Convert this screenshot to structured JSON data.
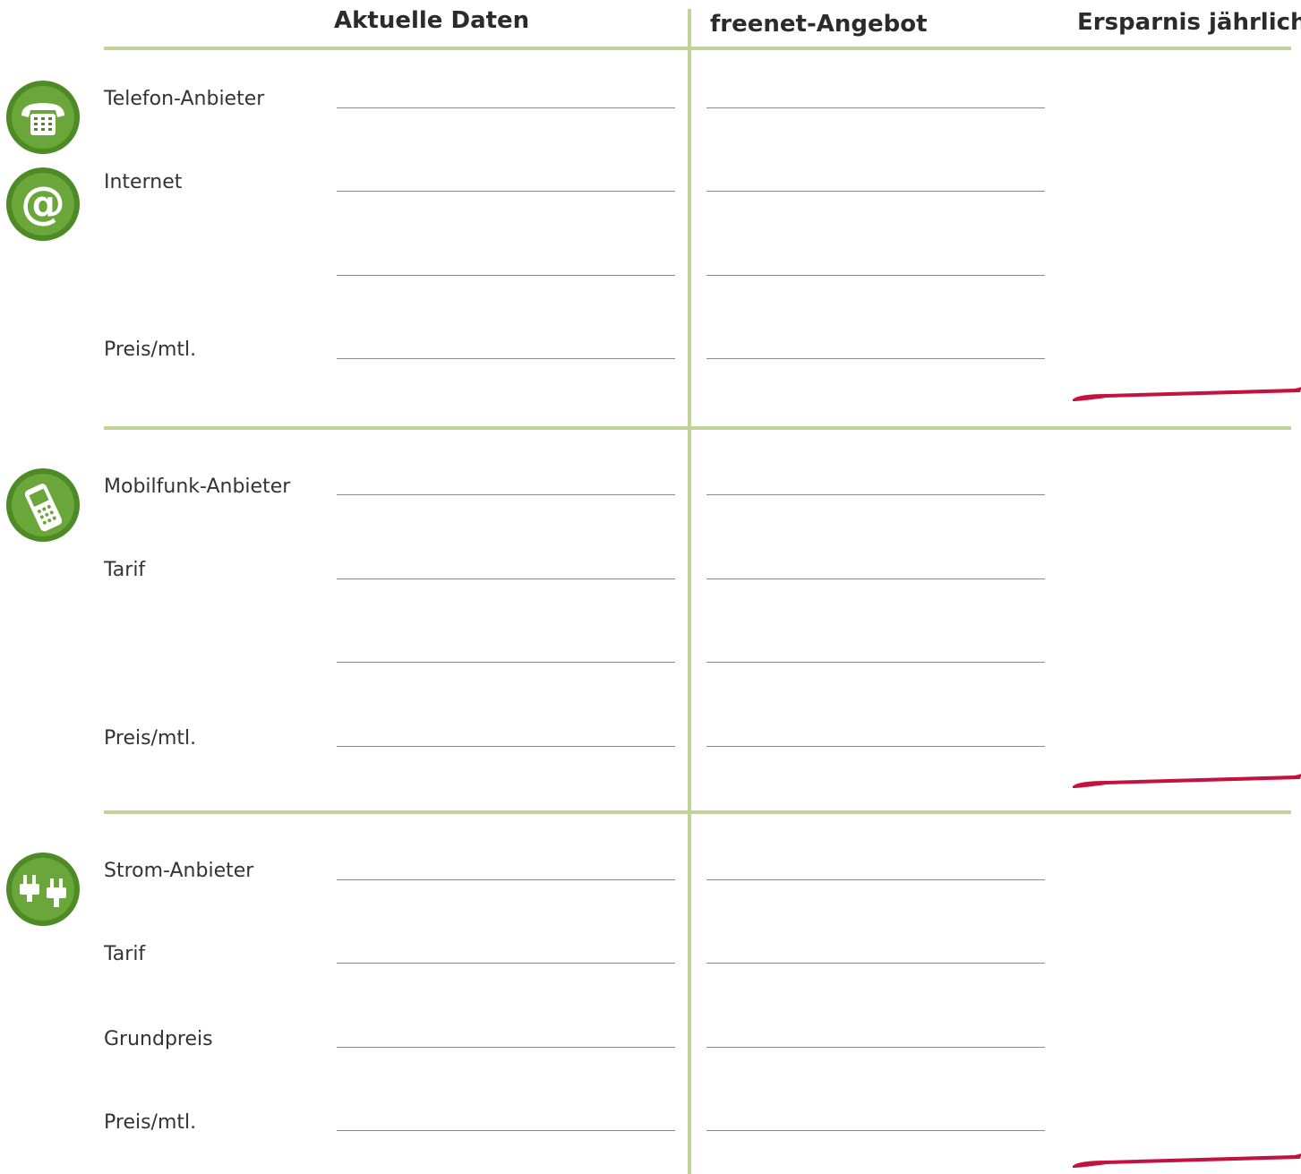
{
  "header": {
    "col_current": "Aktuelle Daten",
    "col_offer": "freenet-Angebot",
    "col_savings": "Ersparnis jährlich"
  },
  "sections": {
    "telefon": {
      "icons": [
        "telephone-icon",
        "at-sign-icon"
      ],
      "labels": [
        "Telefon-Anbieter",
        "Internet",
        "",
        "Preis/mtl."
      ]
    },
    "mobil": {
      "icons": [
        "mobile-phone-icon"
      ],
      "labels": [
        "Mobilfunk-Anbieter",
        "Tarif",
        "",
        "Preis/mtl."
      ]
    },
    "strom": {
      "icons": [
        "power-plug-icon"
      ],
      "labels": [
        "Strom-Anbieter",
        "Tarif",
        "Grundpreis",
        "Preis/mtl."
      ]
    }
  },
  "colors": {
    "accent_green": "#c0d49a",
    "icon_green": "#4e8a25",
    "marker_red": "#c4123e",
    "field_line": "#8a8a8a"
  }
}
